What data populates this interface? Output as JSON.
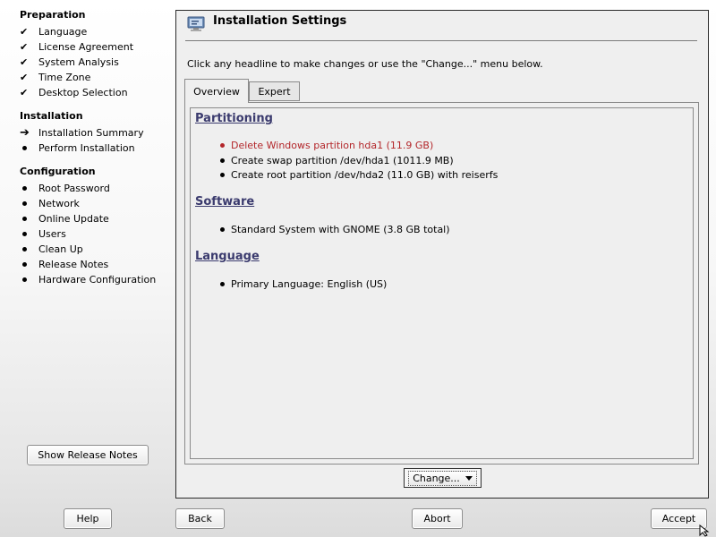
{
  "sidebar": {
    "sections": [
      {
        "title": "Preparation",
        "steps": [
          {
            "label": "Language",
            "state": "done"
          },
          {
            "label": "License Agreement",
            "state": "done"
          },
          {
            "label": "System Analysis",
            "state": "done"
          },
          {
            "label": "Time Zone",
            "state": "done"
          },
          {
            "label": "Desktop Selection",
            "state": "done"
          }
        ]
      },
      {
        "title": "Installation",
        "steps": [
          {
            "label": "Installation Summary",
            "state": "current"
          },
          {
            "label": "Perform Installation",
            "state": "pending"
          }
        ]
      },
      {
        "title": "Configuration",
        "steps": [
          {
            "label": "Root Password",
            "state": "pending"
          },
          {
            "label": "Network",
            "state": "pending"
          },
          {
            "label": "Online Update",
            "state": "pending"
          },
          {
            "label": "Users",
            "state": "pending"
          },
          {
            "label": "Clean Up",
            "state": "pending"
          },
          {
            "label": "Release Notes",
            "state": "pending"
          },
          {
            "label": "Hardware Configuration",
            "state": "pending"
          }
        ]
      }
    ],
    "show_release_notes_label": "Show Release Notes"
  },
  "main": {
    "title": "Installation Settings",
    "title_icon": "monitor-settings-icon",
    "intro": "Click any headline to make changes or use the \"Change...\" menu below.",
    "tabs": [
      {
        "label": "Overview",
        "active": true
      },
      {
        "label": "Expert",
        "active": false
      }
    ],
    "summary": {
      "partitioning": {
        "heading": "Partitioning",
        "items": [
          {
            "text": "Delete Windows partition hda1 (11.9 GB)",
            "warning": true
          },
          {
            "text": "Create swap partition /dev/hda1 (1011.9 MB)",
            "warning": false
          },
          {
            "text": "Create root partition /dev/hda2 (11.0 GB) with reiserfs",
            "warning": false
          }
        ]
      },
      "software": {
        "heading": "Software",
        "items": [
          {
            "text": "Standard System with GNOME (3.8 GB total)",
            "warning": false
          }
        ]
      },
      "language": {
        "heading": "Language",
        "items": [
          {
            "text": "Primary Language: English (US)",
            "warning": false
          }
        ]
      }
    },
    "change_label": "Change..."
  },
  "bottom": {
    "help_label": "Help",
    "back_label": "Back",
    "abort_label": "Abort",
    "accept_label": "Accept"
  },
  "colors": {
    "warning": "#b3262a",
    "heading_link": "#3b3b6e"
  }
}
